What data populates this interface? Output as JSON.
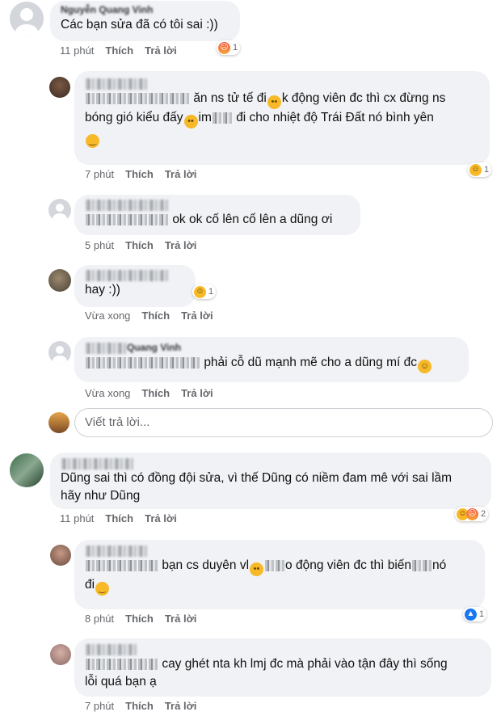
{
  "comments": [
    {
      "id": "c1",
      "name": "Nguyễn Quang Vinh",
      "text": "Các bạn sửa đã có tôi sai :))",
      "time": "11 phút",
      "like": "Thích",
      "reply": "Trả lời",
      "reaction_count": "1"
    },
    {
      "id": "c2",
      "name": "",
      "text": "ăn ns tử tế đi",
      "text2": "k động viên đc thì cx đừng ns",
      "text3": "bóng gió kiểu đấy",
      "text4": "im",
      "text5": "đi cho nhiệt độ Trái Đất nó bình yên",
      "time": "7 phút",
      "like": "Thích",
      "reply": "Trả lời"
    },
    {
      "id": "c3",
      "name": "",
      "text": "ok ok cố lên cố lên a dũng ơi",
      "time": "5 phút",
      "like": "Thích",
      "reply": "Trả lời"
    },
    {
      "id": "c4",
      "name": "",
      "text": "hay :))",
      "time": "Vừa xong",
      "like": "Thích",
      "reply": "Trả lời",
      "reaction_count": "1"
    },
    {
      "id": "c5",
      "name": "Quang Vinh",
      "text": "phải cỗ dũ mạnh mẽ cho a dũng mí đc",
      "time": "Vừa xong",
      "like": "Thích",
      "reply": "Trả lời"
    },
    {
      "id": "c6",
      "name": "",
      "text": "Dũng sai thì có đồng đội sửa, vì thế Dũng có niềm đam mê với sai lầm",
      "text2": "hãy như Dũng",
      "time": "11 phút",
      "like": "Thích",
      "reply": "Trả lời",
      "reaction_count": "2"
    },
    {
      "id": "c7",
      "name": "",
      "text": "bạn cs duyên vl",
      "text2": "o động viên đc thì biến",
      "text3": "nó",
      "text4": "đi",
      "time": "8 phút",
      "like": "Thích",
      "reply": "Trả lời",
      "reaction_count": "1"
    },
    {
      "id": "c8",
      "name": "",
      "text": "cay ghét nta kh lmj đc mà phải vào tận đây thì sống",
      "text2": "lỗi quá bạn ạ",
      "time": "7 phút",
      "like": "Thích",
      "reply": "Trả lời"
    }
  ],
  "reply_box": {
    "placeholder": "Viết trả lời..."
  },
  "reaction_icons": [
    "angry-icon",
    "haha-icon",
    "like-icon"
  ],
  "colors": {
    "bubble": "#f0f2f5",
    "meta": "#65676b",
    "like": "#1877f2"
  }
}
